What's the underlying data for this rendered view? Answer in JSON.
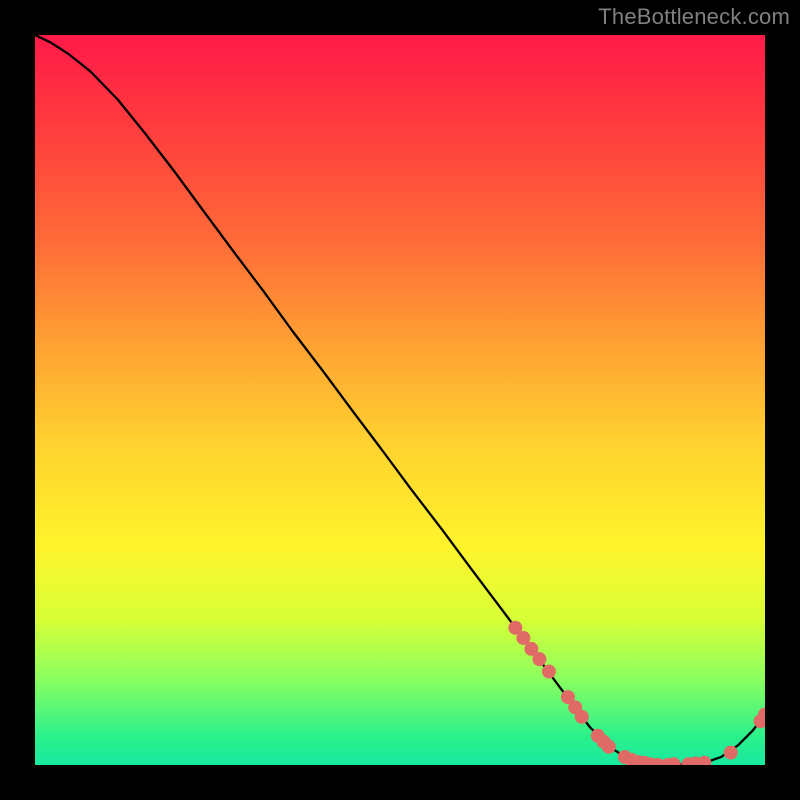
{
  "watermark": "TheBottleneck.com",
  "chart_data": {
    "type": "line",
    "title": "",
    "xlabel": "",
    "ylabel": "",
    "xlim": [
      0,
      1
    ],
    "ylim": [
      0,
      1
    ],
    "grid": false,
    "series": [
      {
        "name": "curve",
        "color": "#000000",
        "points": [
          {
            "x": 0.0,
            "y": 1.0
          },
          {
            "x": 0.021,
            "y": 0.99
          },
          {
            "x": 0.046,
            "y": 0.974
          },
          {
            "x": 0.076,
            "y": 0.95
          },
          {
            "x": 0.113,
            "y": 0.912
          },
          {
            "x": 0.151,
            "y": 0.865
          },
          {
            "x": 0.191,
            "y": 0.813
          },
          {
            "x": 0.23,
            "y": 0.76
          },
          {
            "x": 0.273,
            "y": 0.702
          },
          {
            "x": 0.313,
            "y": 0.649
          },
          {
            "x": 0.353,
            "y": 0.594
          },
          {
            "x": 0.395,
            "y": 0.539
          },
          {
            "x": 0.435,
            "y": 0.485
          },
          {
            "x": 0.475,
            "y": 0.432
          },
          {
            "x": 0.515,
            "y": 0.378
          },
          {
            "x": 0.558,
            "y": 0.322
          },
          {
            "x": 0.598,
            "y": 0.268
          },
          {
            "x": 0.638,
            "y": 0.215
          },
          {
            "x": 0.68,
            "y": 0.159
          },
          {
            "x": 0.72,
            "y": 0.105
          },
          {
            "x": 0.76,
            "y": 0.052
          },
          {
            "x": 0.79,
            "y": 0.023
          },
          {
            "x": 0.81,
            "y": 0.01
          },
          {
            "x": 0.83,
            "y": 0.003
          },
          {
            "x": 0.858,
            "y": 0.0
          },
          {
            "x": 0.89,
            "y": 0.001
          },
          {
            "x": 0.917,
            "y": 0.003
          },
          {
            "x": 0.94,
            "y": 0.011
          },
          {
            "x": 0.963,
            "y": 0.027
          },
          {
            "x": 0.983,
            "y": 0.047
          },
          {
            "x": 1.0,
            "y": 0.069
          }
        ]
      },
      {
        "name": "dots",
        "color": "#e06a66",
        "points": [
          {
            "x": 0.658,
            "y": 0.188,
            "r": 7
          },
          {
            "x": 0.669,
            "y": 0.174,
            "r": 7
          },
          {
            "x": 0.68,
            "y": 0.159,
            "r": 7
          },
          {
            "x": 0.691,
            "y": 0.145,
            "r": 7
          },
          {
            "x": 0.704,
            "y": 0.128,
            "r": 7
          },
          {
            "x": 0.73,
            "y": 0.093,
            "r": 7
          },
          {
            "x": 0.74,
            "y": 0.079,
            "r": 7
          },
          {
            "x": 0.749,
            "y": 0.066,
            "r": 7
          },
          {
            "x": 0.771,
            "y": 0.04,
            "r": 7
          },
          {
            "x": 0.779,
            "y": 0.032,
            "r": 7
          },
          {
            "x": 0.786,
            "y": 0.025,
            "r": 7
          },
          {
            "x": 0.808,
            "y": 0.011,
            "r": 7
          },
          {
            "x": 0.817,
            "y": 0.007,
            "r": 7
          },
          {
            "x": 0.826,
            "y": 0.004,
            "r": 7
          },
          {
            "x": 0.834,
            "y": 0.003,
            "r": 7
          },
          {
            "x": 0.843,
            "y": 0.001,
            "r": 7
          },
          {
            "x": 0.853,
            "y": 0.0,
            "r": 7
          },
          {
            "x": 0.867,
            "y": 0.0,
            "r": 7
          },
          {
            "x": 0.875,
            "y": 0.001,
            "r": 7
          },
          {
            "x": 0.895,
            "y": 0.001,
            "r": 7
          },
          {
            "x": 0.905,
            "y": 0.002,
            "r": 7
          },
          {
            "x": 0.917,
            "y": 0.003,
            "r": 7
          },
          {
            "x": 0.953,
            "y": 0.017,
            "r": 7
          },
          {
            "x": 0.994,
            "y": 0.06,
            "r": 7
          },
          {
            "x": 1.0,
            "y": 0.069,
            "r": 7
          }
        ]
      }
    ]
  }
}
